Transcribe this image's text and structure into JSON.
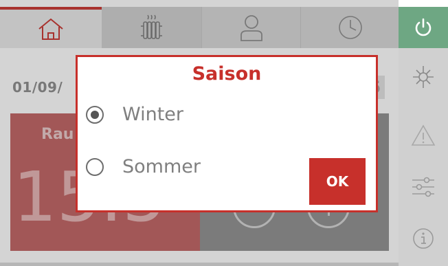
{
  "tabs": [
    {
      "icon": "home-icon"
    },
    {
      "icon": "radiator-icon"
    },
    {
      "icon": "user-icon"
    },
    {
      "icon": "clock-icon"
    }
  ],
  "sidebar": {
    "power_icon": "power-icon",
    "season_icon": "sun-snowflake-icon",
    "warning_icon": "warning-icon",
    "settings_icon": "sliders-icon",
    "info_icon": "info-icon",
    "power_color": "#6ea783"
  },
  "main": {
    "date": "01/09/",
    "time_partial": "5",
    "room_label": "Rau",
    "room_temp": "15.5"
  },
  "dialog": {
    "title": "Saison",
    "options": [
      {
        "label": "Winter",
        "selected": true
      },
      {
        "label": "Sommer",
        "selected": false
      }
    ],
    "ok_label": "OK"
  },
  "colors": {
    "accent": "#c7302b",
    "room_panel": "#bf5f5f",
    "set_panel": "#8e8e8e"
  }
}
